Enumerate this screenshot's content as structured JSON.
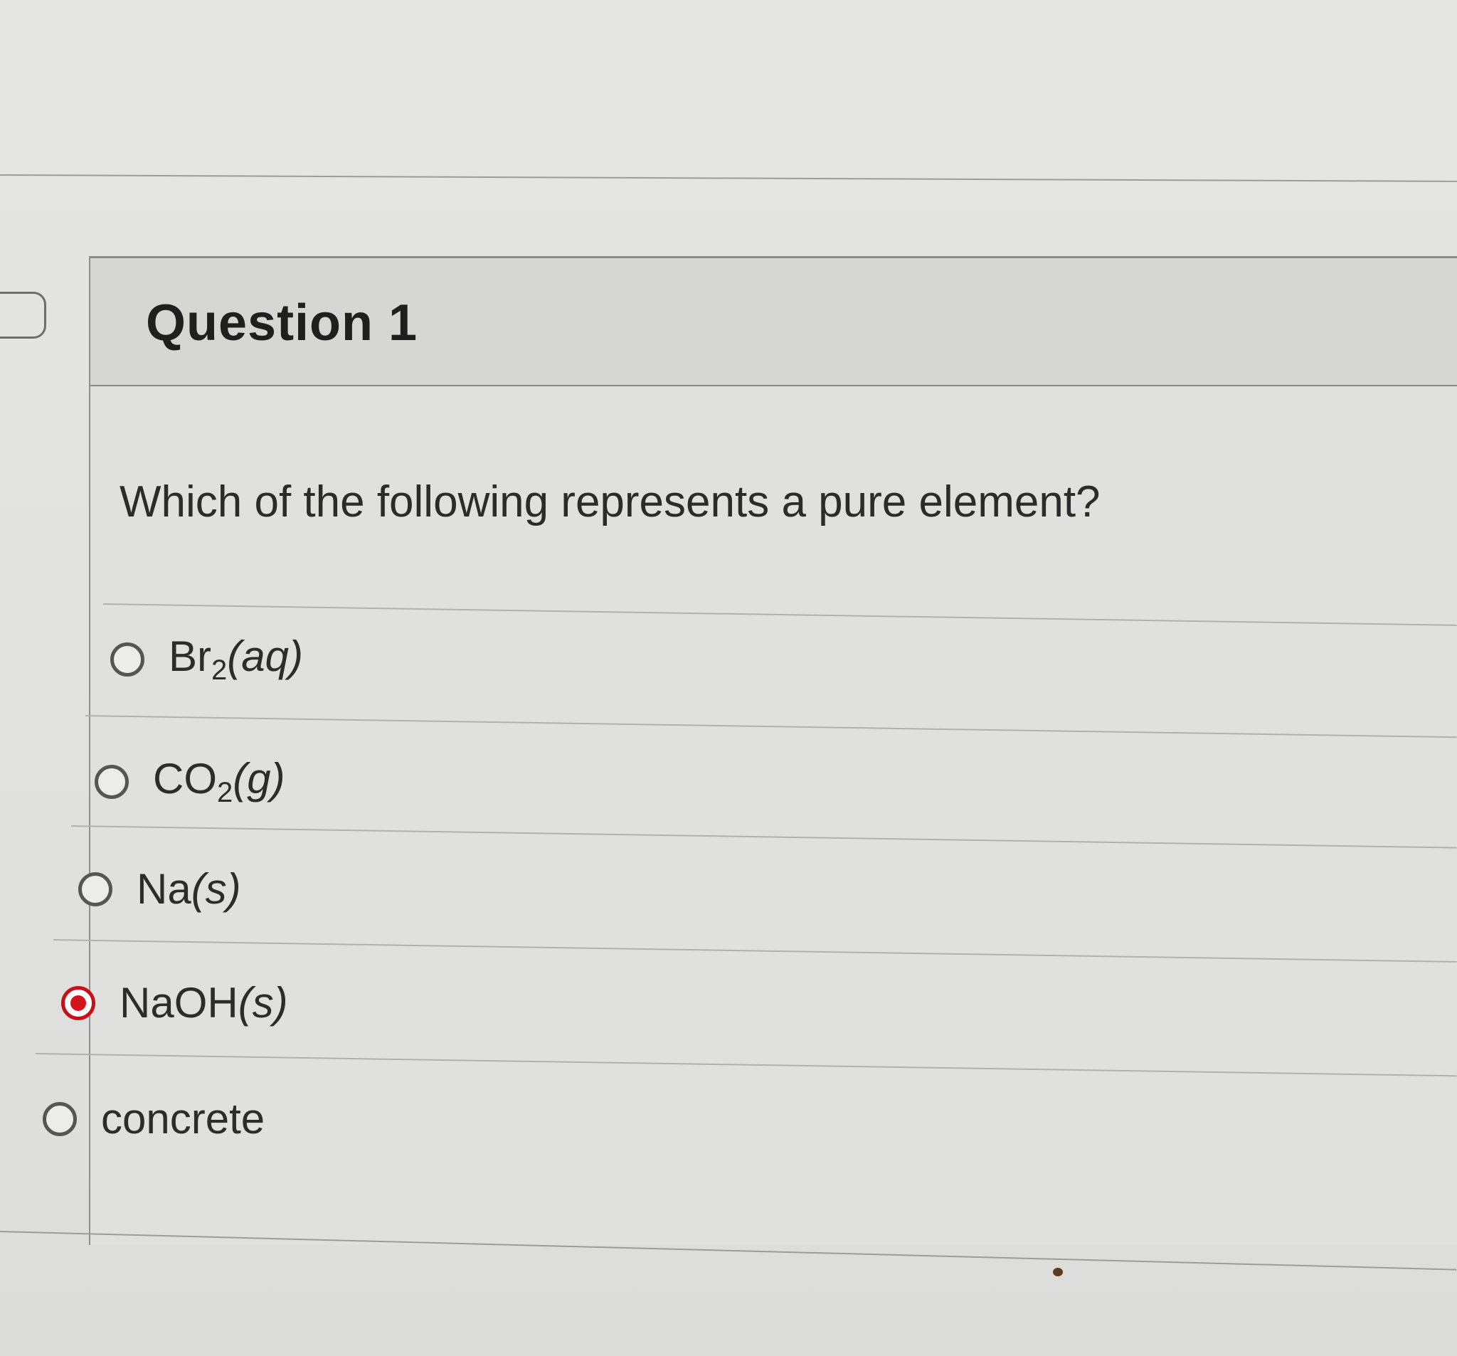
{
  "question": {
    "title": "Question 1",
    "prompt": "Which of the following represents a pure element?",
    "options": [
      {
        "formula_main": "Br",
        "formula_sub": "2",
        "state": "(aq)",
        "selected": false
      },
      {
        "formula_main": "CO",
        "formula_sub": "2",
        "state": "(g)",
        "selected": false
      },
      {
        "formula_main": "Na",
        "formula_sub": "",
        "state": "(s)",
        "selected": false
      },
      {
        "formula_main": "NaOH",
        "formula_sub": "",
        "state": "(s)",
        "selected": true
      },
      {
        "formula_main": "concrete",
        "formula_sub": "",
        "state": "",
        "selected": false
      }
    ]
  },
  "colors": {
    "selected_radio": "#d3141e",
    "radio_border": "#555553",
    "background": "#e3e3e1"
  }
}
